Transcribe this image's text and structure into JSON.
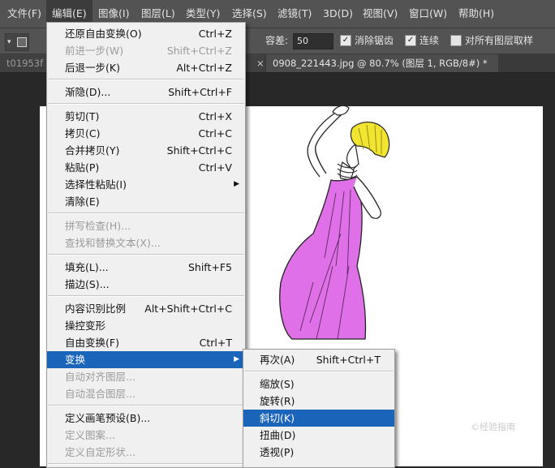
{
  "menubar": [
    "文件(F)",
    "编辑(E)",
    "图像(I)",
    "图层(L)",
    "类型(Y)",
    "选择(S)",
    "滤镜(T)",
    "3D(D)",
    "视图(V)",
    "窗口(W)",
    "帮助(H)"
  ],
  "options": {
    "tolerance_label": "容差:",
    "tolerance_value": "50",
    "antialias_label": "消除锯齿",
    "contiguous_label": "连续",
    "sample_all_label": "对所有图层取样"
  },
  "tabs": {
    "tab1": "t01953f",
    "tab1_close": "×",
    "tab2": "0908_221443.jpg @ 80.7% (图层 1, RGB/8#) *",
    "tab2_close": "×"
  },
  "edit_menu": {
    "items": [
      {
        "label": "还原自由变换(O)",
        "shortcut": "Ctrl+Z"
      },
      {
        "label": "前进一步(W)",
        "shortcut": "Shift+Ctrl+Z"
      },
      {
        "label": "后退一步(K)",
        "shortcut": "Alt+Ctrl+Z"
      },
      {
        "label": "渐隐(D)...",
        "shortcut": "Shift+Ctrl+F"
      },
      {
        "label": "剪切(T)",
        "shortcut": "Ctrl+X"
      },
      {
        "label": "拷贝(C)",
        "shortcut": "Ctrl+C"
      },
      {
        "label": "合并拷贝(Y)",
        "shortcut": "Shift+Ctrl+C"
      },
      {
        "label": "粘贴(P)",
        "shortcut": "Ctrl+V"
      },
      {
        "label": "选择性粘贴(I)",
        "shortcut": ""
      },
      {
        "label": "清除(E)",
        "shortcut": ""
      },
      {
        "label": "拼写检查(H)...",
        "shortcut": ""
      },
      {
        "label": "查找和替换文本(X)...",
        "shortcut": ""
      },
      {
        "label": "填充(L)...",
        "shortcut": "Shift+F5"
      },
      {
        "label": "描边(S)...",
        "shortcut": ""
      },
      {
        "label": "内容识别比例",
        "shortcut": "Alt+Shift+Ctrl+C"
      },
      {
        "label": "操控变形",
        "shortcut": ""
      },
      {
        "label": "自由变换(F)",
        "shortcut": "Ctrl+T"
      },
      {
        "label": "变换",
        "shortcut": ""
      },
      {
        "label": "自动对齐图层...",
        "shortcut": ""
      },
      {
        "label": "自动混合图层...",
        "shortcut": ""
      },
      {
        "label": "定义画笔预设(B)...",
        "shortcut": ""
      },
      {
        "label": "定义图案...",
        "shortcut": ""
      },
      {
        "label": "定义自定形状...",
        "shortcut": ""
      }
    ],
    "submenu_arrow": "▶"
  },
  "transform_submenu": {
    "items": [
      {
        "label": "再次(A)",
        "shortcut": "Shift+Ctrl+T"
      },
      {
        "label": "缩放(S)",
        "shortcut": ""
      },
      {
        "label": "旋转(R)",
        "shortcut": ""
      },
      {
        "label": "斜切(K)",
        "shortcut": ""
      },
      {
        "label": "扭曲(D)",
        "shortcut": ""
      },
      {
        "label": "透视(P)",
        "shortcut": ""
      }
    ]
  },
  "colors": {
    "menu_highlight": "#1a64b9",
    "dress": "#e070e8",
    "hair": "#f2e531"
  }
}
